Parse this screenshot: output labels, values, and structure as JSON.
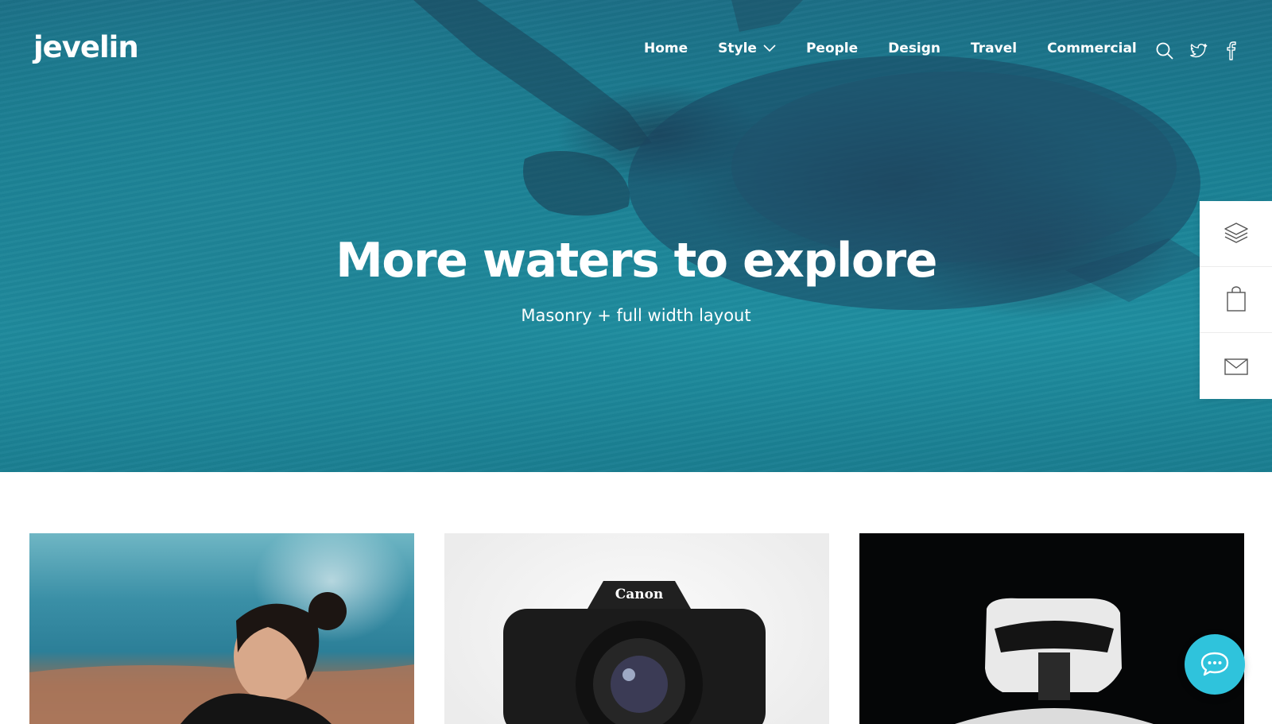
{
  "brand": {
    "logo_text": "jevelin"
  },
  "nav": {
    "items": [
      {
        "label": "Home",
        "has_dropdown": false
      },
      {
        "label": "Style",
        "has_dropdown": true
      },
      {
        "label": "People",
        "has_dropdown": false
      },
      {
        "label": "Design",
        "has_dropdown": false
      },
      {
        "label": "Travel",
        "has_dropdown": false
      },
      {
        "label": "Commercial",
        "has_dropdown": false
      }
    ],
    "icons": [
      "search-icon",
      "twitter-icon",
      "facebook-icon"
    ]
  },
  "hero": {
    "title": "More waters to explore",
    "subtitle": "Masonry + full width layout"
  },
  "side_panel": {
    "buttons": [
      "layers-icon",
      "shopping-bag-icon",
      "mail-icon"
    ]
  },
  "gallery": {
    "cards": [
      {
        "image": "woman-by-sea-photo"
      },
      {
        "image": "canon-camera-photo",
        "visible_text": "Canon"
      },
      {
        "image": "stormtrooper-helmet-photo"
      }
    ]
  },
  "chat": {
    "icon": "chat-bubble-icon"
  },
  "colors": {
    "hero_water": "#1a7f93",
    "accent_chat": "#2fc3dc",
    "text_light": "#ffffff",
    "panel_bg": "#ffffff"
  }
}
